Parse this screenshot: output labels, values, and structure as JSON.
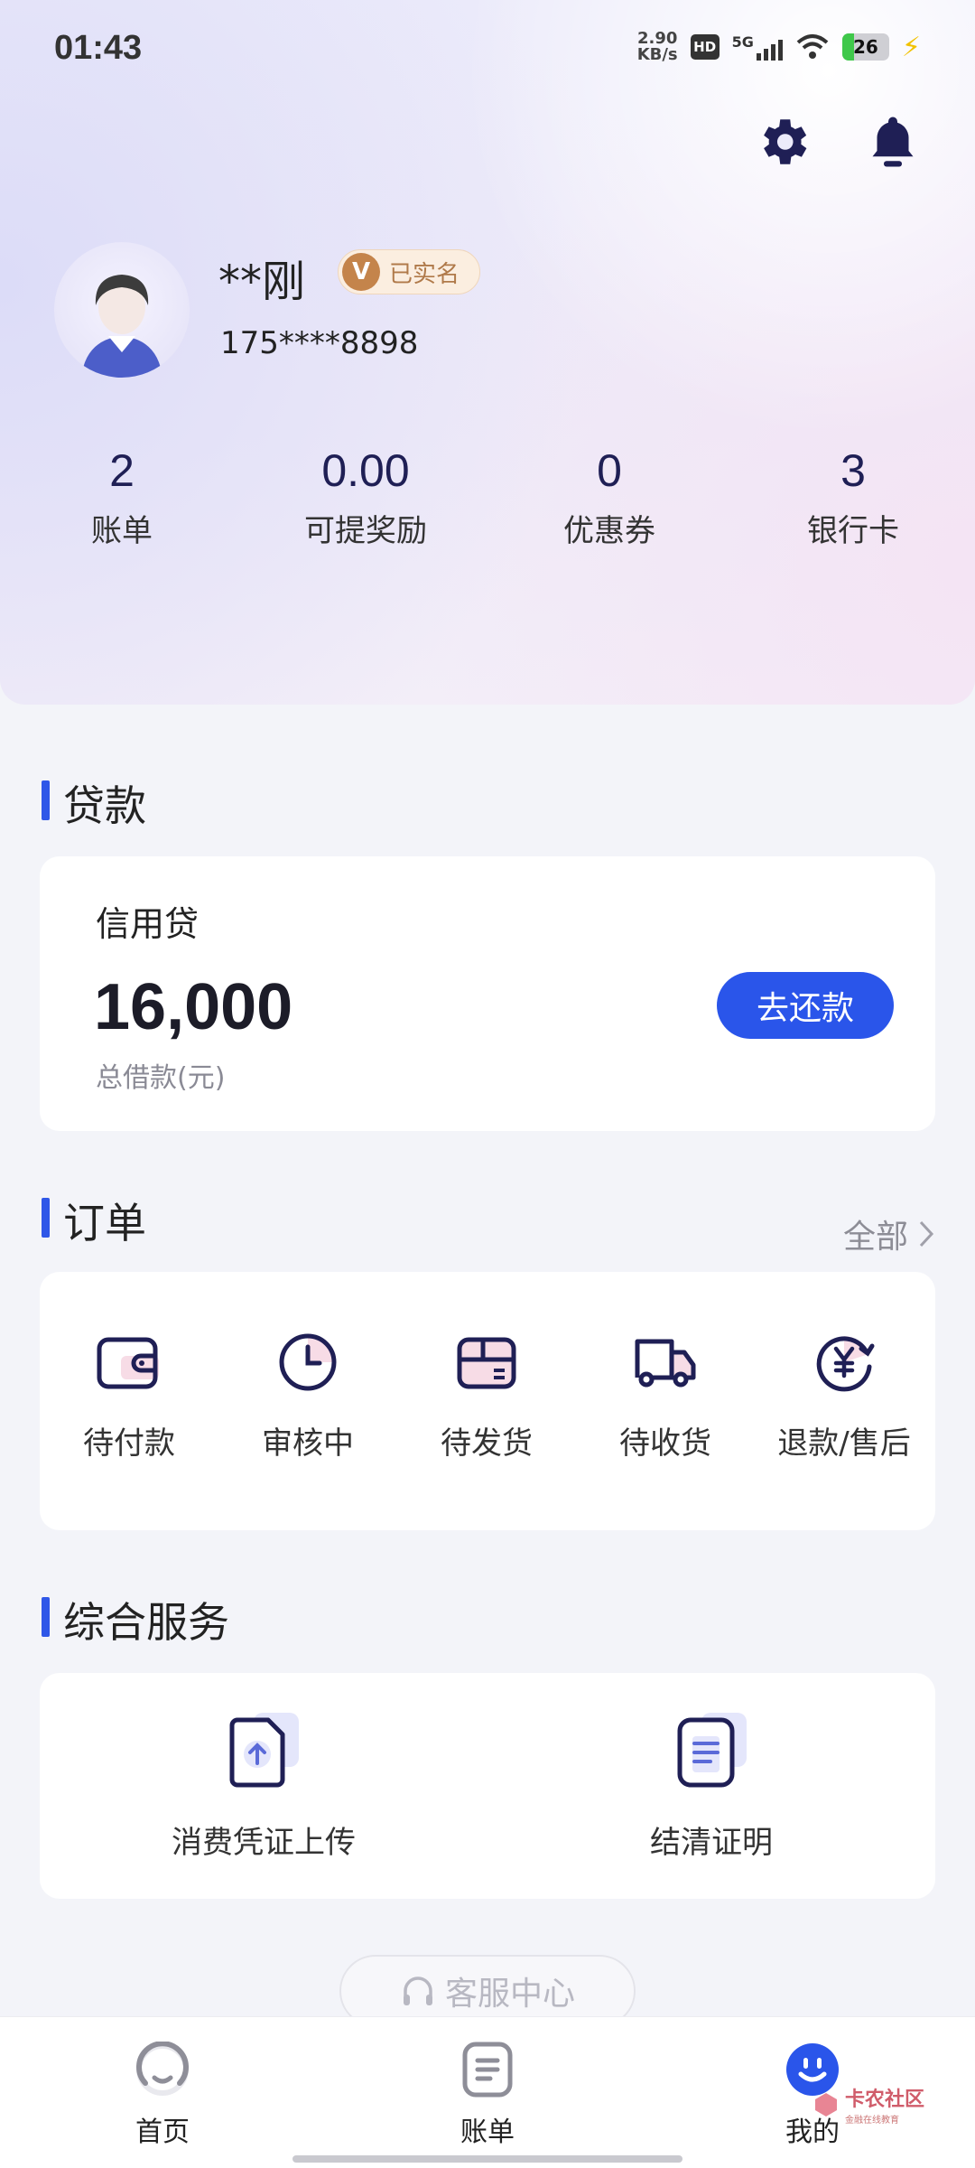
{
  "status_bar": {
    "time": "01:43",
    "net_speed_value": "2.90",
    "net_speed_unit": "KB/s",
    "hd_label": "HD",
    "signal_label": "5G",
    "battery_level": "26",
    "battery_fraction": 0.26
  },
  "profile": {
    "name": "**刚",
    "verified_badge_letter": "V",
    "verified_label": "已实名",
    "phone": "175****8898"
  },
  "stats": [
    {
      "value": "2",
      "label": "账单"
    },
    {
      "value": "0.00",
      "label": "可提奖励"
    },
    {
      "value": "0",
      "label": "优惠券"
    },
    {
      "value": "3",
      "label": "银行卡"
    }
  ],
  "loan_section": {
    "title": "贷款",
    "product": "信用贷",
    "amount": "16,000",
    "amount_label": "总借款(元)",
    "repay_button": "去还款"
  },
  "order_section": {
    "title": "订单",
    "see_all": "全部",
    "items": [
      {
        "label": "待付款",
        "icon": "wallet-icon"
      },
      {
        "label": "审核中",
        "icon": "clock-icon"
      },
      {
        "label": "待发货",
        "icon": "package-icon"
      },
      {
        "label": "待收货",
        "icon": "truck-icon"
      },
      {
        "label": "退款/售后",
        "icon": "yuan-refund-icon"
      }
    ]
  },
  "service_section": {
    "title": "综合服务",
    "items": [
      {
        "label": "消费凭证上传",
        "icon": "upload-document-icon"
      },
      {
        "label": "结清证明",
        "icon": "certificate-document-icon"
      }
    ]
  },
  "customer_service": {
    "label": "客服中心"
  },
  "bottom_nav": [
    {
      "label": "首页",
      "icon": "home-icon"
    },
    {
      "label": "账单",
      "icon": "bill-icon"
    },
    {
      "label": "我的",
      "icon": "smile-profile-icon",
      "active": true
    }
  ],
  "watermark": {
    "text": "卡农社区",
    "subtext": "金融在线教育"
  },
  "colors": {
    "accent": "#2a55ea",
    "section_bar": "#2f57e8",
    "icon_stroke": "#1f1f55",
    "badge_bg": "#fbeee0",
    "badge_text": "#b07a4a"
  }
}
